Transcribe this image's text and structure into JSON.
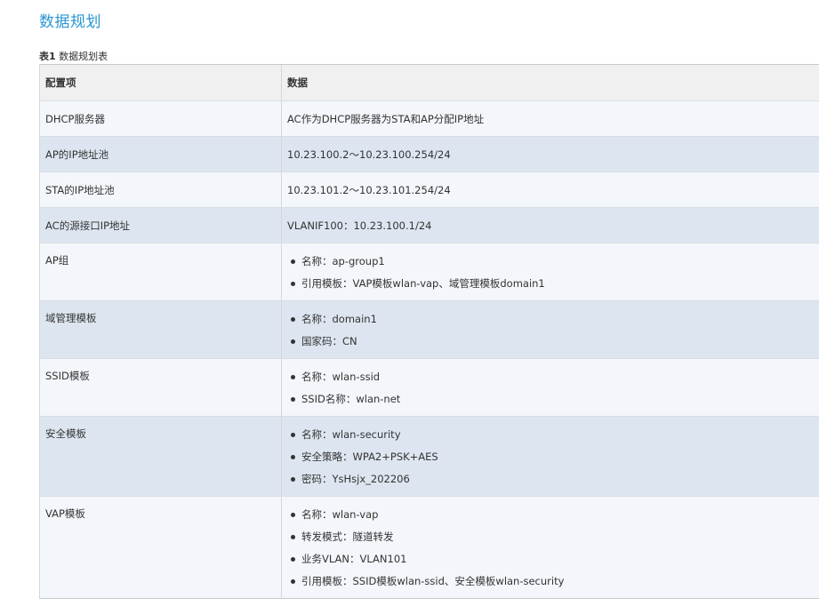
{
  "page": {
    "title": "数据规划",
    "table_caption_num": "表1",
    "table_caption_text": "数据规划表"
  },
  "table": {
    "headers": [
      "配置项",
      "数据"
    ],
    "rows": [
      {
        "item": "DHCP服务器",
        "value": "AC作为DHCP服务器为STA和AP分配IP地址"
      },
      {
        "item": "AP的IP地址池",
        "value": "10.23.100.2～10.23.100.254/24"
      },
      {
        "item": "STA的IP地址池",
        "value": "10.23.101.2～10.23.101.254/24"
      },
      {
        "item": "AC的源接口IP地址",
        "value": "VLANIF100：10.23.100.1/24"
      },
      {
        "item": "AP组",
        "bullets": [
          "名称：ap-group1",
          "引用模板：VAP模板wlan-vap、域管理模板domain1"
        ]
      },
      {
        "item": "域管理模板",
        "bullets": [
          "名称：domain1",
          "国家码：CN"
        ]
      },
      {
        "item": "SSID模板",
        "bullets": [
          "名称：wlan-ssid",
          "SSID名称：wlan-net"
        ]
      },
      {
        "item": "安全模板",
        "bullets": [
          "名称：wlan-security",
          "安全策略：WPA2+PSK+AES",
          "密码：YsHsjx_202206"
        ]
      },
      {
        "item": "VAP模板",
        "bullets": [
          "名称：wlan-vap",
          "转发模式：隧道转发",
          "业务VLAN：VLAN101",
          "引用模板：SSID模板wlan-ssid、安全模板wlan-security"
        ]
      }
    ]
  }
}
